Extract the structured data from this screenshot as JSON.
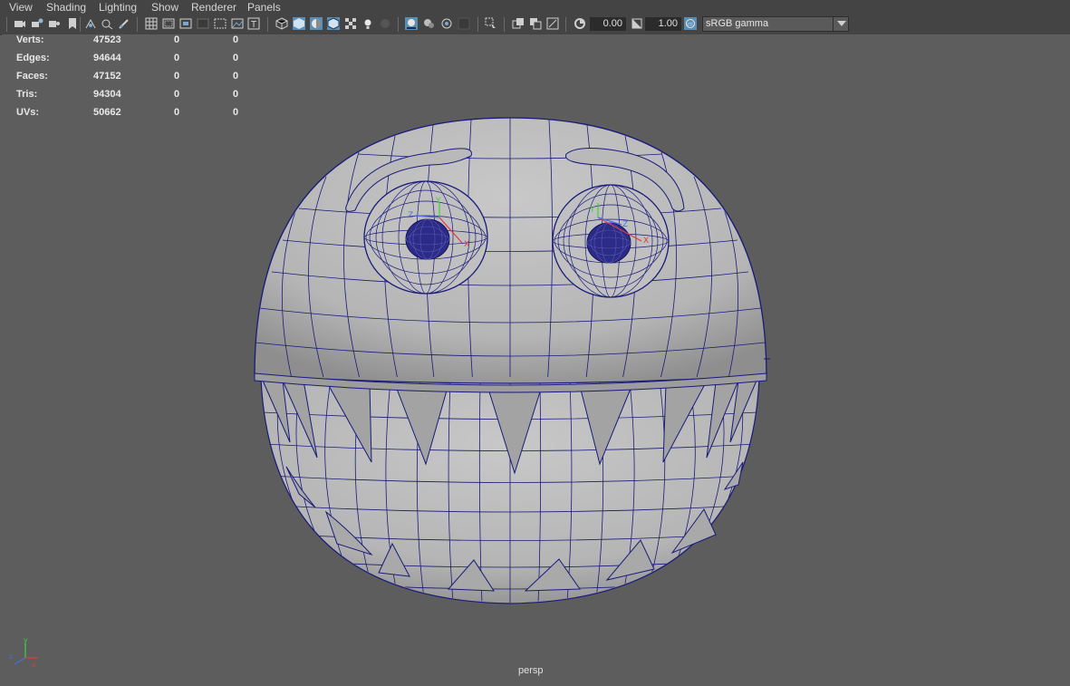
{
  "menubar": {
    "items": [
      {
        "label": "View"
      },
      {
        "label": "Shading"
      },
      {
        "label": "Lighting"
      },
      {
        "label": "Show"
      },
      {
        "label": "Renderer"
      },
      {
        "label": "Panels"
      }
    ]
  },
  "toolbar": {
    "icons": [
      "camera-icon",
      "camera-attributes-icon",
      "bookmark-icon",
      "image-plane-icon",
      "film-gate-icon",
      "resolution-gate-icon",
      "gate-mask-icon",
      "field-chart-icon",
      "safe-action-icon",
      "safe-title-icon",
      "grease-pencil-icon",
      "wireframe-icon",
      "smooth-shade-icon",
      "default-material-icon",
      "use-all-lights-icon",
      "shadows-icon",
      "isolate-select-icon",
      "xray-icon",
      "xray-joints-icon",
      "backface-icon",
      "highlight-icon",
      "snap-icon",
      "frame-all-icon",
      "frame-selected-icon",
      "exposure-icon",
      "gamma-icon",
      "view-transform-icon"
    ],
    "exposure_value": "0.00",
    "gamma_value": "1.00",
    "color_space": "sRGB gamma"
  },
  "hud": {
    "rows": [
      {
        "label": "Verts:",
        "total": "47523",
        "selected": "0",
        "components": "0"
      },
      {
        "label": "Edges:",
        "total": "94644",
        "selected": "0",
        "components": "0"
      },
      {
        "label": "Faces:",
        "total": "47152",
        "selected": "0",
        "components": "0"
      },
      {
        "label": "Tris:",
        "total": "94304",
        "selected": "0",
        "components": "0"
      },
      {
        "label": "UVs:",
        "total": "50662",
        "selected": "0",
        "components": "0"
      }
    ]
  },
  "viewport": {
    "camera_label": "persp",
    "axis_y": "y",
    "axis_x": "x",
    "axis_z": "z",
    "wire_color": "#1a1a7a",
    "mesh_color": "#b8b8b8"
  }
}
